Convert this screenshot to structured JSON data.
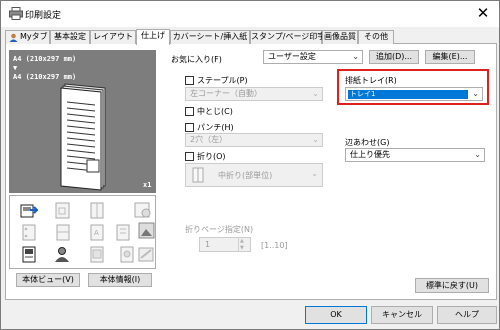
{
  "window": {
    "title": "印刷設定",
    "close_glyph": "✕"
  },
  "tabs": [
    {
      "label": "Myタブ",
      "icon": "user-icon"
    },
    {
      "label": "基本設定"
    },
    {
      "label": "レイアウト"
    },
    {
      "label": "仕上げ",
      "active": true
    },
    {
      "label": "カバーシート/挿入紙"
    },
    {
      "label": "スタンプ/ページ印字"
    },
    {
      "label": "画像品質"
    },
    {
      "label": "その他"
    }
  ],
  "preview": {
    "paper_line1": "A4 (210x297 mm)",
    "arrow": "▼",
    "paper_line2": "A4 (210x297 mm)",
    "copies": "x1",
    "view_button": "本体ビュー(V)",
    "info_button": "本体情報(I)"
  },
  "favorites": {
    "label": "お気に入り(F)",
    "value": "ユーザー設定",
    "add_button": "追加(D)...",
    "edit_button": "編集(E)..."
  },
  "staple": {
    "label": "ステープル(P)",
    "value": "左コーナー（自動）"
  },
  "center_staple": {
    "label": "中とじ(C)"
  },
  "punch": {
    "label": "パンチ(H)",
    "value": "2穴（左）"
  },
  "fold": {
    "label": "折り(O)",
    "value": "中折り(部単位)"
  },
  "output_tray": {
    "label": "排紙トレイ(R)",
    "value": "トレイ1"
  },
  "binding_position": {
    "label": "辺あわせ(G)",
    "value": "仕上り優先"
  },
  "fold_page": {
    "label": "折りページ指定(N)",
    "value": "1",
    "range": "[1..10]"
  },
  "reset_button": "標準に戻す(U)",
  "footer": {
    "ok": "OK",
    "cancel": "キャンセル",
    "help": "ヘルプ"
  },
  "colors": {
    "highlight": "#e0201c",
    "selection": "#0078d7",
    "preview_bg": "#7d7d7d"
  }
}
